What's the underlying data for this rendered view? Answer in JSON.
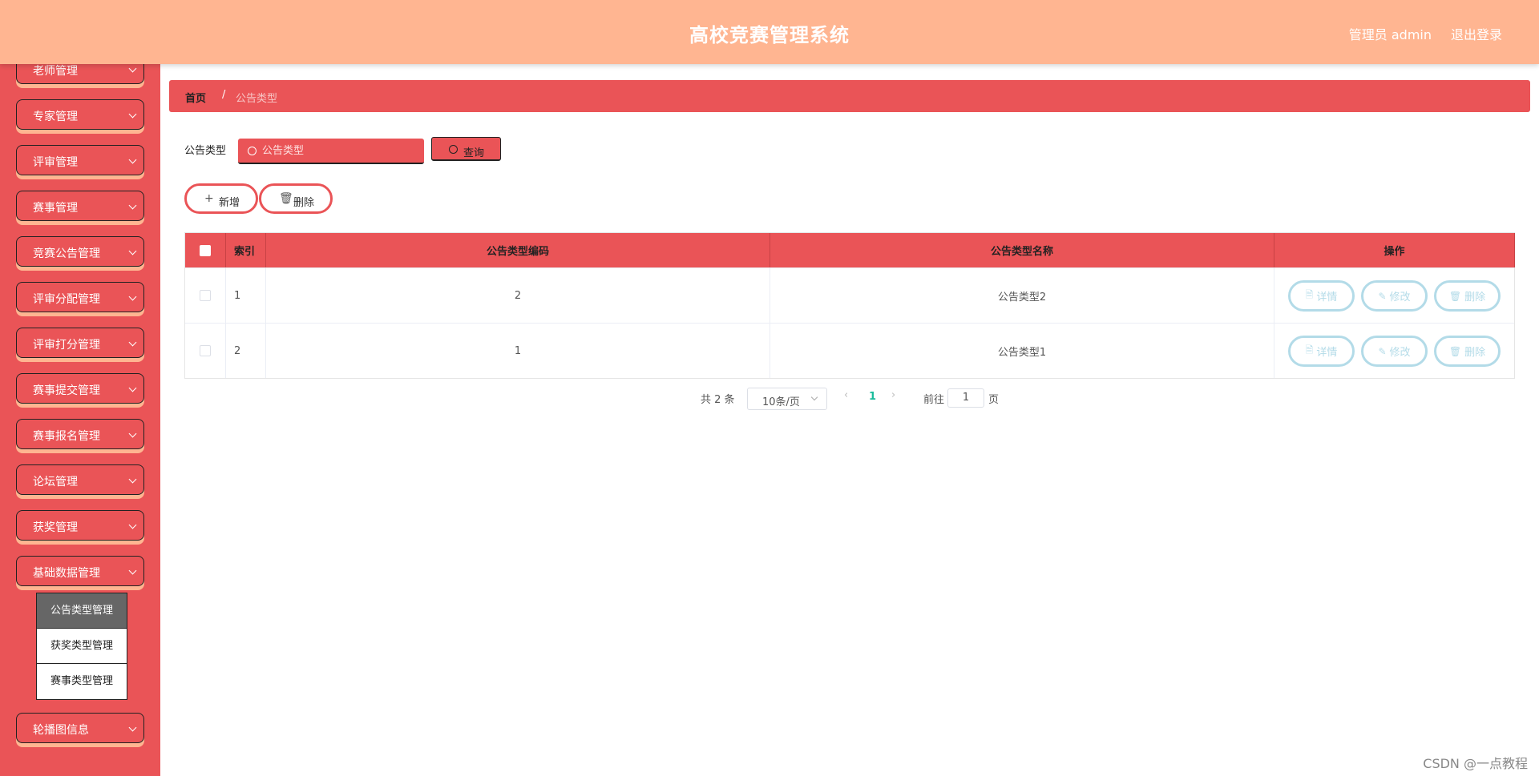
{
  "header": {
    "title": "高校竞赛管理系统",
    "user": "管理员 admin",
    "logout": "退出登录"
  },
  "sidebar": {
    "items": [
      {
        "label": "老师管理"
      },
      {
        "label": "专家管理"
      },
      {
        "label": "评审管理"
      },
      {
        "label": "赛事管理"
      },
      {
        "label": "竞赛公告管理"
      },
      {
        "label": "评审分配管理"
      },
      {
        "label": "评审打分管理"
      },
      {
        "label": "赛事提交管理"
      },
      {
        "label": "赛事报名管理"
      },
      {
        "label": "论坛管理"
      },
      {
        "label": "获奖管理"
      },
      {
        "label": "基础数据管理"
      },
      {
        "label": "轮播图信息"
      }
    ],
    "submenu": [
      {
        "label": "公告类型管理",
        "active": true
      },
      {
        "label": "获奖类型管理"
      },
      {
        "label": "赛事类型管理"
      }
    ]
  },
  "breadcrumb": {
    "home": "首页",
    "sep": "/",
    "current": "公告类型"
  },
  "search": {
    "label": "公告类型",
    "placeholder": "公告类型",
    "button": "查询"
  },
  "actions": {
    "add": "新增",
    "delete": "删除"
  },
  "table": {
    "headers": {
      "index": "索引",
      "code": "公告类型编码",
      "name": "公告类型名称",
      "ops": "操作"
    },
    "rows": [
      {
        "index": "1",
        "code": "2",
        "name": "公告类型2"
      },
      {
        "index": "2",
        "code": "1",
        "name": "公告类型1"
      }
    ],
    "ops": {
      "detail": "详情",
      "edit": "修改",
      "delete": "删除"
    }
  },
  "pagination": {
    "total": "共 2 条",
    "page_size": "10条/页",
    "current_page": "1",
    "goto_label": "前往",
    "goto_value": "1",
    "page_unit": "页"
  },
  "watermark": "CSDN @一点教程",
  "colors": {
    "header": "#FFB591",
    "accent": "#EA5457",
    "op_border": "#B3DBE8"
  }
}
